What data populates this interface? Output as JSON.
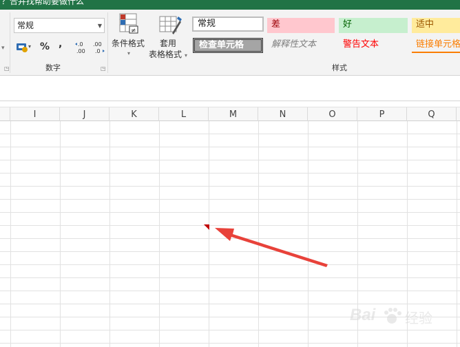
{
  "window": {
    "title": "？合并找帮助要做什么"
  },
  "ribbon": {
    "number_group": {
      "label": "数字",
      "format_value": "常规",
      "percent_symbol": "%",
      "comma_symbol": ",",
      "increase_decimal_text": "←.0\n.00",
      "decrease_decimal_text": ".00\n→.0"
    },
    "styles_group": {
      "label": "样式",
      "conditional_format_label": "条件格式",
      "table_format_label_1": "套用",
      "table_format_label_2": "表格格式",
      "cells": {
        "normal": "常规",
        "bad": "差",
        "good": "好",
        "neutral": "适中",
        "check_cell": "检查单元格",
        "explanatory": "解释性文本",
        "warning": "警告文本",
        "linked_cell": "链接单元格"
      }
    }
  },
  "sheet": {
    "columns": [
      "I",
      "J",
      "K",
      "L",
      "M",
      "N",
      "O",
      "P",
      "Q"
    ]
  },
  "watermark": {
    "brand": "Bai",
    "suffix": "经验"
  },
  "colors": {
    "title_bar": "#217346",
    "bad_bg": "#ffc7ce",
    "bad_fg": "#9c0006",
    "good_bg": "#c6efce",
    "good_fg": "#006100",
    "neutral_bg": "#ffeb9c",
    "neutral_fg": "#9c5700",
    "check_bg": "#a5a5a5",
    "warning_fg": "#ff0000",
    "link_fg": "#fa7d00",
    "arrow": "#e8423a"
  }
}
